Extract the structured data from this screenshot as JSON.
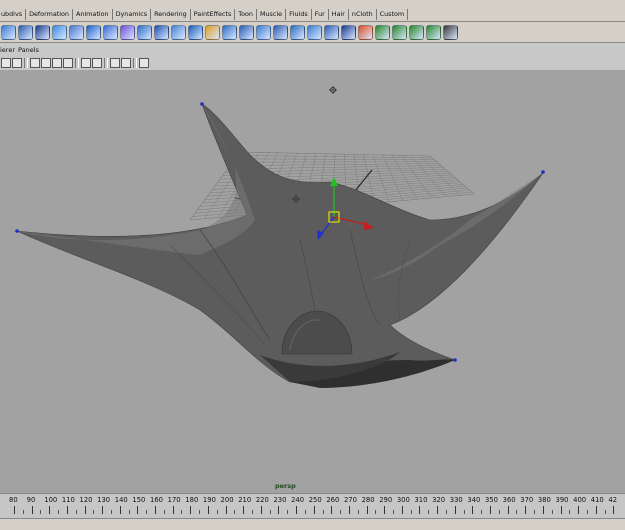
{
  "shelf_tabs": [
    "ubdivs",
    "Deformation",
    "Animation",
    "Dynamics",
    "Rendering",
    "PaintEffects",
    "Toon",
    "Muscle",
    "Fluids",
    "Fur",
    "Hair",
    "nCloth",
    "Custom"
  ],
  "panel_menu": [
    "ierer",
    "Panels"
  ],
  "viewport": {
    "camera": "persp"
  },
  "timeline": {
    "ticks": [
      "80",
      "90",
      "100",
      "110",
      "120",
      "130",
      "140",
      "150",
      "160",
      "170",
      "180",
      "190",
      "200",
      "210",
      "220",
      "230",
      "240",
      "250",
      "260",
      "270",
      "280",
      "290",
      "300",
      "310",
      "320",
      "330",
      "340",
      "350",
      "360",
      "370",
      "380",
      "390",
      "400",
      "410",
      "42"
    ]
  },
  "colors": {
    "viewport_bg": "#a2a2a2",
    "cloth": "#5e5e5e",
    "grid": "#7a7a7a",
    "manip_y": "#20c020",
    "manip_x": "#c02020",
    "manip_z": "#2030d0",
    "vertex": "#2030c0"
  }
}
